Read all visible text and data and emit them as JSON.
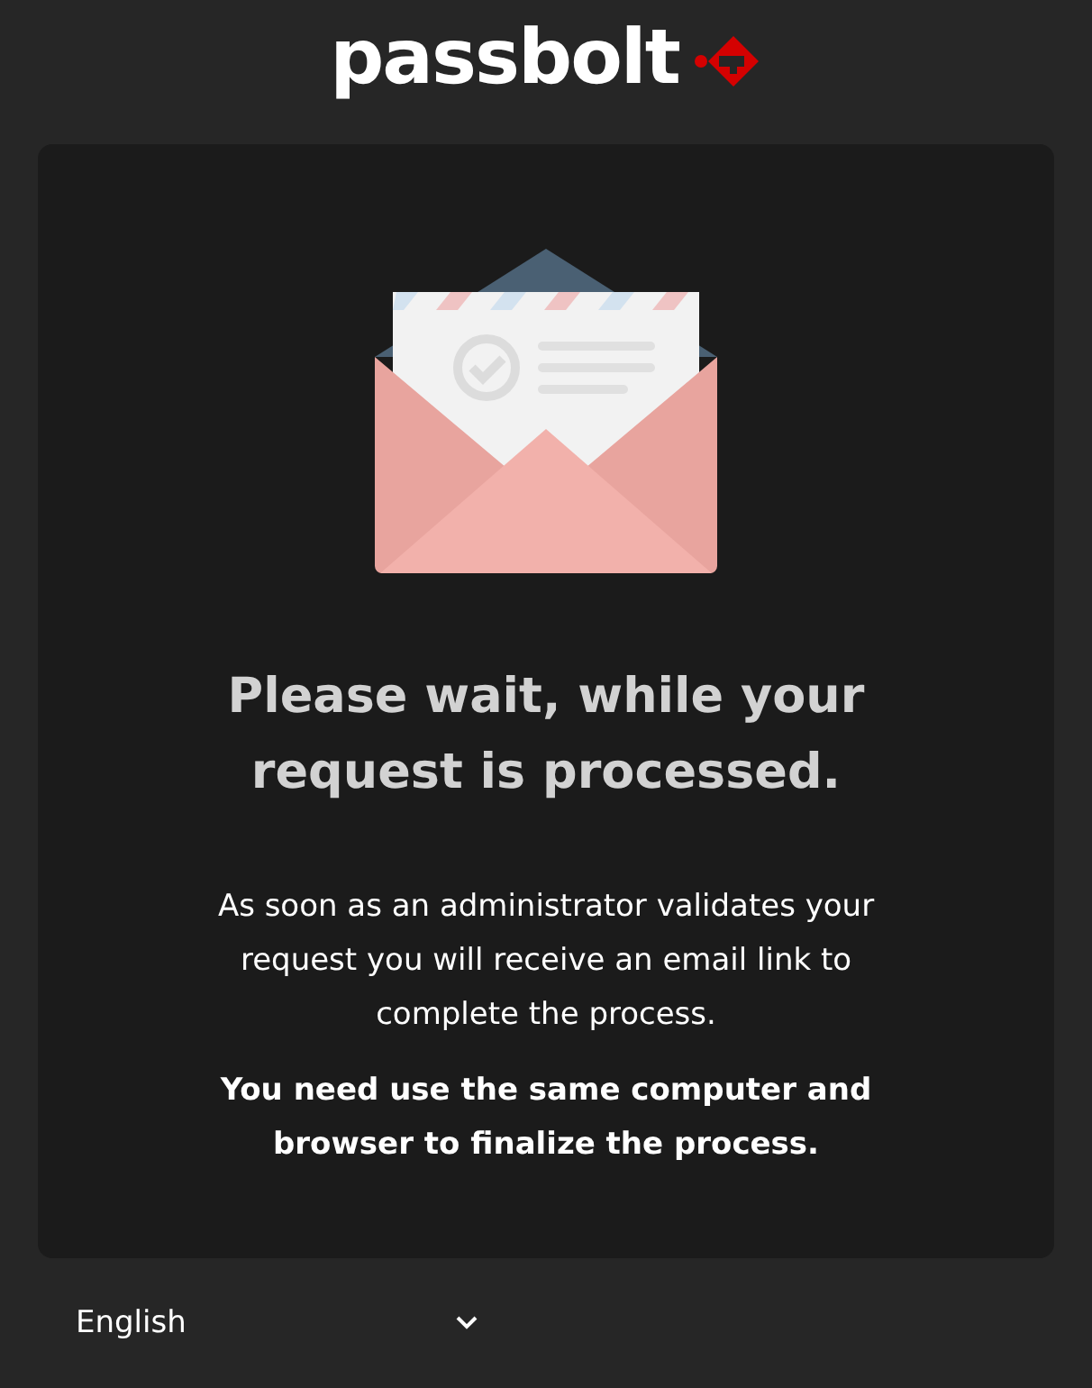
{
  "logo": {
    "text": "passbolt"
  },
  "card": {
    "title": "Please wait, while your request is processed.",
    "message": "As soon as an administrator validates your request you will receive an email link to complete the process.",
    "note": "You need use the same computer and browser to finalize the process."
  },
  "language": {
    "value": "English"
  }
}
